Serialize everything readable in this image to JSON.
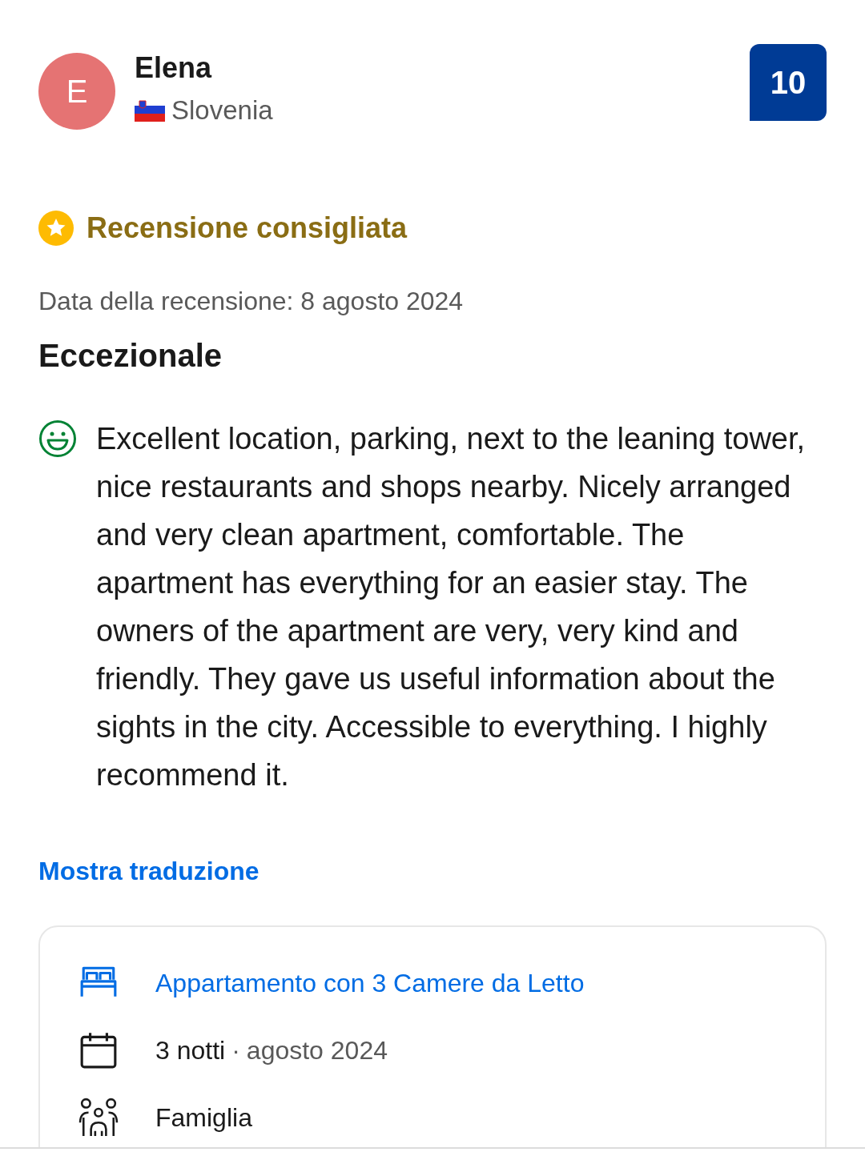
{
  "reviewer": {
    "initial": "E",
    "name": "Elena",
    "country": "Slovenia"
  },
  "score": "10",
  "badge": {
    "label": "Recensione consigliata"
  },
  "review_date": "Data della recensione: 8 agosto 2024",
  "title": "Eccezionale",
  "positive": {
    "text": "Excellent location, parking, next to the leaning tower, nice restaurants and shops nearby. Nicely arranged and very clean apartment, comfortable. The apartment has everything for an easier stay. The owners of the apartment are very, very kind and friendly. They gave us useful information about the sights in the city. Accessible to everything. I highly recommend it."
  },
  "translate_link": "Mostra traduzione",
  "details": [
    {
      "kind": "room",
      "text": "Appartamento con 3 Camere da Letto"
    },
    {
      "kind": "stay",
      "text": "3 notti",
      "separator": "·",
      "period": "agosto 2024"
    },
    {
      "kind": "travelers",
      "text": "Famiglia"
    }
  ]
}
